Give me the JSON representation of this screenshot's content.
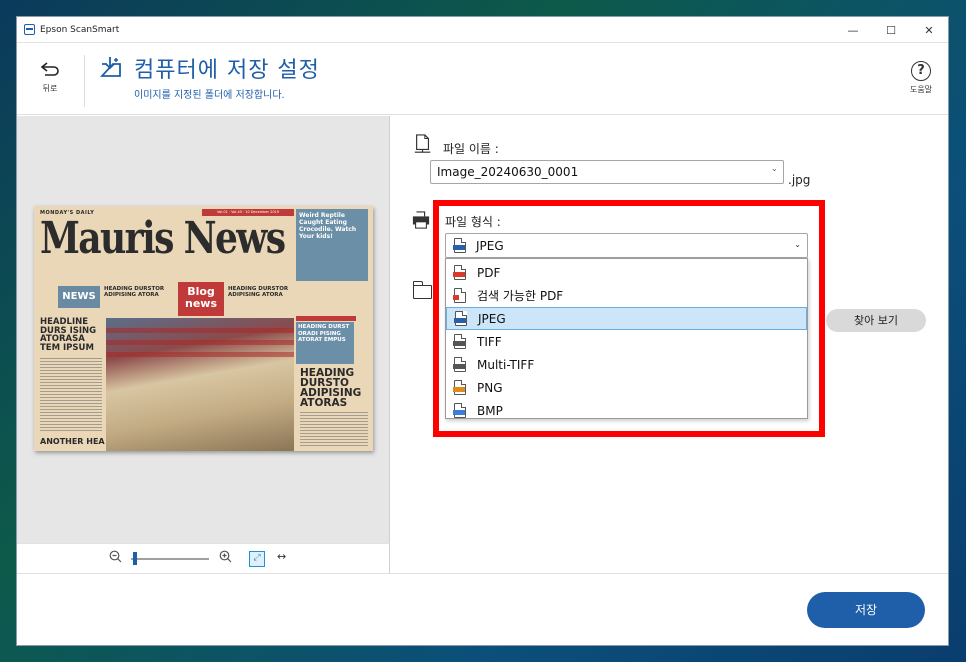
{
  "window": {
    "title": "Epson ScanSmart",
    "controls": {
      "minimize": "—",
      "maximize": "☐",
      "close": "✕"
    }
  },
  "header": {
    "back_label": "뒤로",
    "title": "컴퓨터에 저장 설정",
    "subtitle": "이미지를 지정된 폴더에 저장합니다.",
    "help_label": "도움말",
    "help_glyph": "?"
  },
  "preview": {
    "newspaper": {
      "top_line": "MONDAY'S DAILY",
      "date_bar": "Vol.01 · Vol.45 · 10 December 2019",
      "masthead": "Mauris News",
      "side_top": "Weird Reptile Caught Eating Crocodile. Watch Your kids!",
      "news_box": "NEWS",
      "col1_head": "HEADING DURSTOR ADIPISING ATORA",
      "blog_box": "Blog news",
      "col2_head": "HEADING DURSTOR ADIPISING ATORA",
      "side_mid": "HEADING DURST ORADI PISING ATORAT EMPUS",
      "head_left": "HEADLINE DURS ISING ATORASA TEM IPSUM",
      "head_right": "HEADING DURSTO ADIPISING ATORAS",
      "another": "ANOTHER HEA"
    }
  },
  "zoom": {
    "out_icon": "zoom-out-icon",
    "in_icon": "zoom-in-icon",
    "level": 0.05,
    "fit_glyph": "⤢",
    "arrows_glyph": "↔"
  },
  "file_name": {
    "label": "파일 이름 :",
    "value": "Image_20240630_0001",
    "extension": ".jpg"
  },
  "file_format": {
    "label": "파일 형식 :",
    "selected": "JPEG",
    "options": [
      {
        "label": "PDF",
        "color": "#d93a2b"
      },
      {
        "label": "검색 가능한 PDF",
        "color": "#d93a2b"
      },
      {
        "label": "JPEG",
        "color": "#2b5fa8"
      },
      {
        "label": "TIFF",
        "color": "#555555"
      },
      {
        "label": "Multi-TIFF",
        "color": "#555555"
      },
      {
        "label": "PNG",
        "color": "#e08a1e"
      },
      {
        "label": "BMP",
        "color": "#3b7dd8"
      }
    ]
  },
  "folder": {
    "browse_label": "찾아 보기"
  },
  "footer": {
    "save_label": "저장"
  },
  "colors": {
    "accent": "#1f5faa",
    "highlight_border": "#ff0000",
    "selected_bg": "#cce5f8"
  }
}
